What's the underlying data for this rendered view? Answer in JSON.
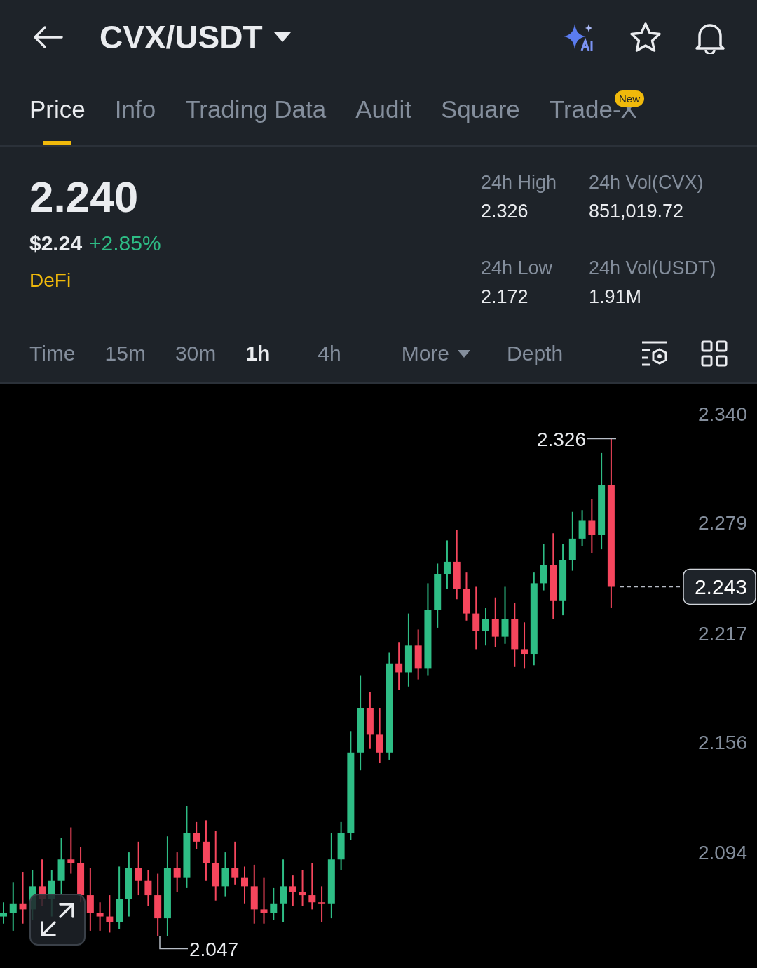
{
  "header": {
    "title": "CVX/USDT"
  },
  "tabs": [
    {
      "label": "Price",
      "selected": true
    },
    {
      "label": "Info",
      "selected": false
    },
    {
      "label": "Trading Data",
      "selected": false
    },
    {
      "label": "Audit",
      "selected": false
    },
    {
      "label": "Square",
      "selected": false
    },
    {
      "label": "Trade-X",
      "selected": false,
      "badge": "New"
    }
  ],
  "price": {
    "last": "2.240",
    "usd": "$2.24",
    "change": "+2.85%",
    "tag": "DeFi"
  },
  "stats": [
    {
      "label": "24h High",
      "value": "2.326"
    },
    {
      "label": "24h Vol(CVX)",
      "value": "851,019.72"
    },
    {
      "label": "24h Low",
      "value": "2.172"
    },
    {
      "label": "24h Vol(USDT)",
      "value": "1.91M"
    }
  ],
  "intervals": [
    {
      "label": "Time",
      "selected": false,
      "kind": "plain"
    },
    {
      "label": "15m",
      "selected": false,
      "kind": "plain"
    },
    {
      "label": "30m",
      "selected": false,
      "kind": "plain"
    },
    {
      "label": "1h",
      "selected": true,
      "kind": "plain"
    },
    {
      "label": "4h",
      "selected": false,
      "kind": "plain"
    },
    {
      "label": "More",
      "selected": false,
      "kind": "dropdown"
    },
    {
      "label": "Depth",
      "selected": false,
      "kind": "plain"
    }
  ],
  "chart": {
    "axis_labels": [
      "2.340",
      "2.279",
      "2.217",
      "2.156",
      "2.094"
    ],
    "high_marker": "2.326",
    "low_marker": "2.047",
    "last_price": "2.243"
  }
}
